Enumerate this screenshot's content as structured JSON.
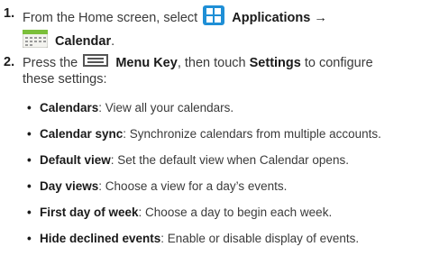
{
  "steps": [
    {
      "num": "1.",
      "pre": "From the Home screen, select",
      "app_icon": "applications-grid-icon",
      "apps_label": "Applications",
      "arrow": "→",
      "cal_icon": "calendar-icon",
      "cal_label": "Calendar",
      "end": "."
    },
    {
      "num": "2.",
      "pre": "Press the",
      "menu_icon": "menu-key-icon",
      "menu_label": "Menu Key",
      "mid": ", then touch",
      "settings_label": "Settings",
      "post": "to configure",
      "line2": "these settings:"
    }
  ],
  "settings": [
    {
      "term": "Calendars",
      "desc": ": View all your calendars."
    },
    {
      "term": "Calendar sync",
      "desc": ": Synchronize calendars from multiple accounts."
    },
    {
      "term": "Default view",
      "desc": ": Set the default view when Calendar opens."
    },
    {
      "term": "Day views",
      "desc": ": Choose a view for a day’s events."
    },
    {
      "term": "First day of week",
      "desc": ": Choose a day to begin each week."
    },
    {
      "term": "Hide declined events",
      "desc": ": Enable or disable display of events."
    }
  ],
  "colors": {
    "apps_icon": "#1f8fd6",
    "calendar_icon": "#7bbf3a"
  }
}
